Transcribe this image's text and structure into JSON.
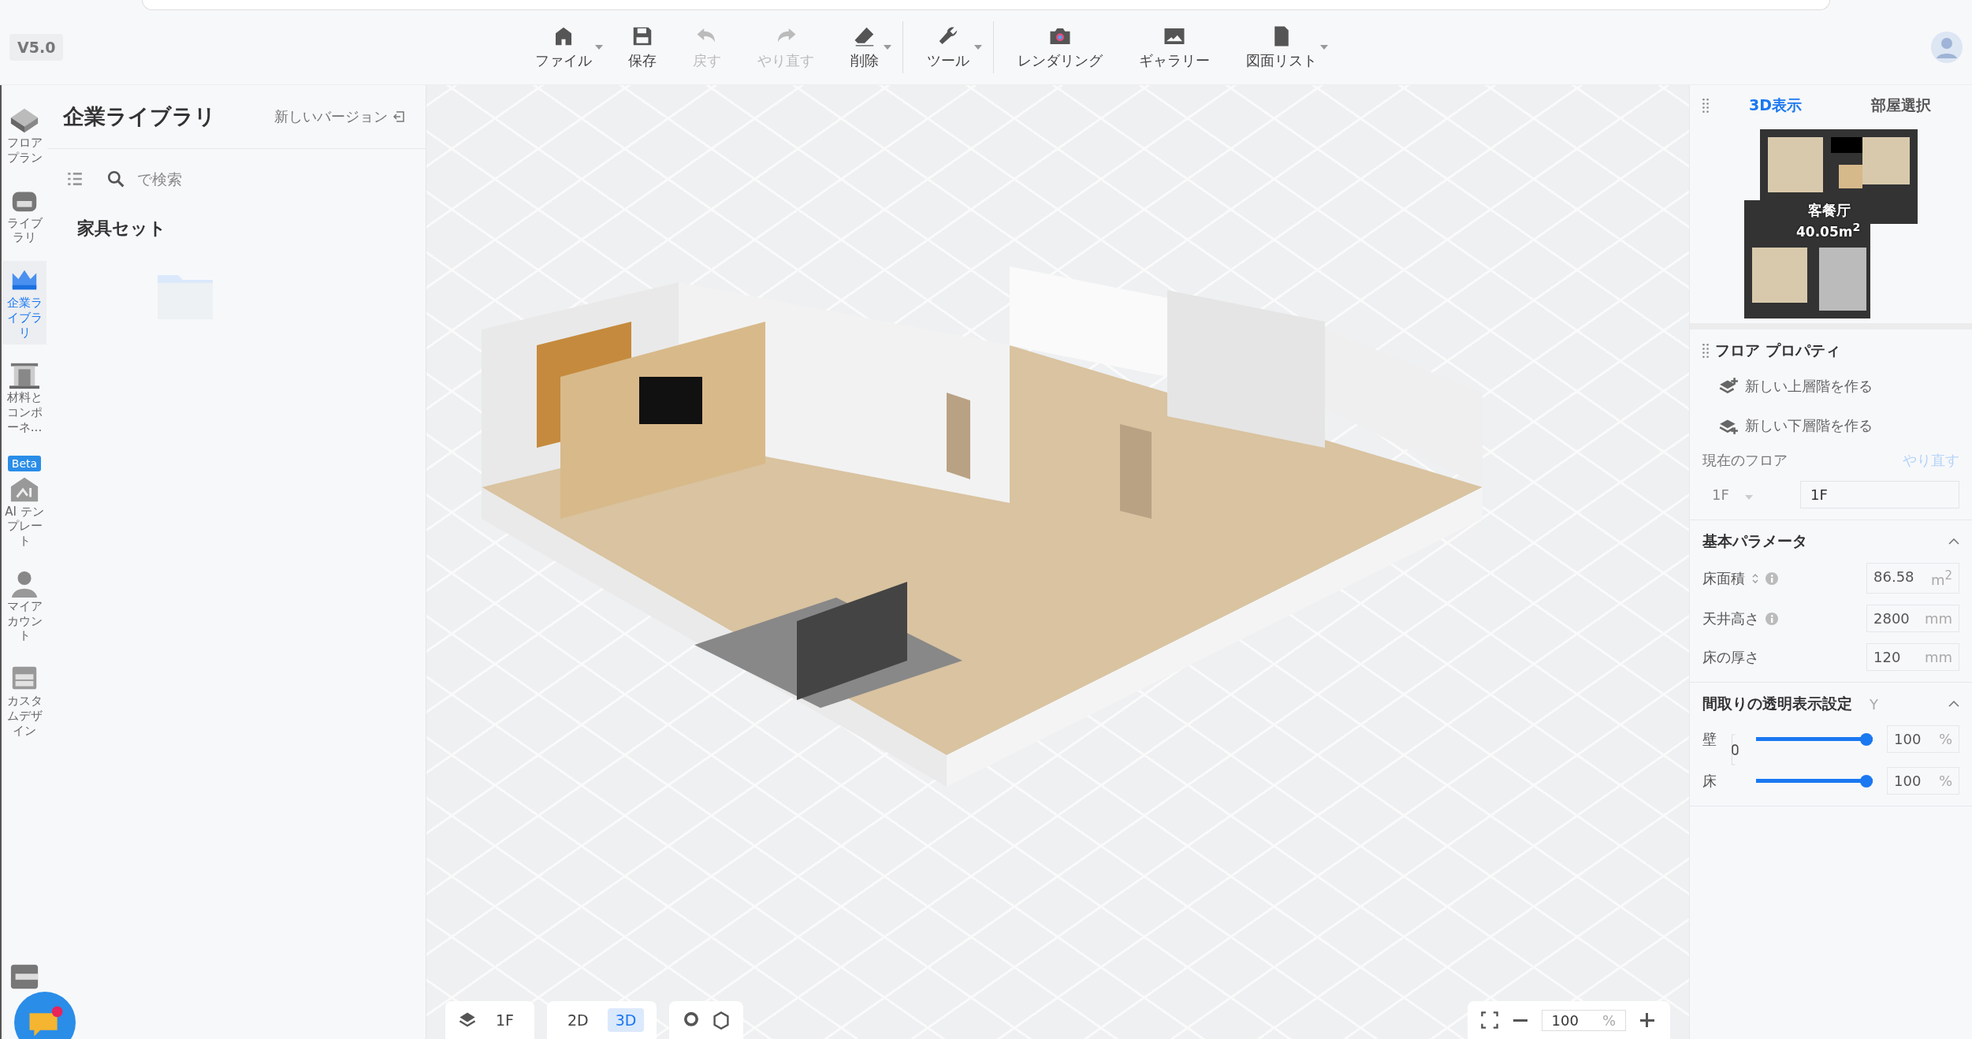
{
  "version": "V5.0",
  "toolbar": [
    {
      "label": "ファイル",
      "dropdown": true,
      "disabled": false,
      "divider_after": false
    },
    {
      "label": "保存",
      "dropdown": false,
      "disabled": false,
      "divider_after": false
    },
    {
      "label": "戻す",
      "dropdown": false,
      "disabled": true,
      "divider_after": false
    },
    {
      "label": "やり直す",
      "dropdown": false,
      "disabled": true,
      "divider_after": false
    },
    {
      "label": "削除",
      "dropdown": true,
      "disabled": false,
      "divider_after": true
    },
    {
      "label": "ツール",
      "dropdown": true,
      "disabled": false,
      "divider_after": true
    },
    {
      "label": "レンダリング",
      "dropdown": false,
      "disabled": false,
      "divider_after": false
    },
    {
      "label": "ギャラリー",
      "dropdown": false,
      "disabled": false,
      "divider_after": false
    },
    {
      "label": "図面リスト",
      "dropdown": true,
      "disabled": false,
      "divider_after": false
    }
  ],
  "rail": [
    {
      "label": "フロアプラン",
      "selected": false
    },
    {
      "label": "ライブラリ",
      "selected": false
    },
    {
      "label": "企業ライブラリ",
      "selected": true
    },
    {
      "label": "材料とコンポーネ...",
      "selected": false
    },
    {
      "label": "AI テンプレート",
      "selected": false,
      "badge": "Beta"
    },
    {
      "label": "マイアカウント",
      "selected": false
    },
    {
      "label": "カスタムデザイン",
      "selected": false
    }
  ],
  "library": {
    "title": "企業ライブラリ",
    "new_version": "新しいバージョン",
    "search": {
      "placeholder": "で検索"
    },
    "section": "家具セット"
  },
  "bottom_bar": {
    "floor": "1F",
    "views": [
      {
        "label": "2D",
        "selected": false
      },
      {
        "label": "3D",
        "selected": true
      }
    ],
    "zoom": "100",
    "zoom_unit": "%"
  },
  "right_panel": {
    "tabs": [
      {
        "label": "3D表示",
        "selected": true
      },
      {
        "label": "部屋選択",
        "selected": false
      }
    ],
    "minimap": {
      "room": "客餐厅",
      "area": "40.05m$^{2}$"
    },
    "floor_properties": {
      "title": "フロア プロパティ",
      "actions": [
        {
          "label": "新しい上層階を作る"
        },
        {
          "label": "新しい下層階を作る"
        }
      ],
      "current_floor_label": "現在のフロア",
      "redo": "やり直す",
      "floor_select": "1F",
      "floor_name": "1F"
    },
    "basic_params": {
      "title": "基本パラメータ",
      "expanded": true,
      "rows": [
        {
          "label": "床面積",
          "sort": true,
          "info": true,
          "value": "86.58",
          "unit": "m$^{2}$"
        },
        {
          "label": "天井高さ",
          "sort": false,
          "info": true,
          "value": "2800",
          "unit": "mm"
        },
        {
          "label": "床の厚さ",
          "sort": false,
          "info": false,
          "value": "120",
          "unit": "mm"
        }
      ]
    },
    "transparency": {
      "title": "間取りの透明表示設定",
      "hint": "Y",
      "expanded": true,
      "sliders": [
        {
          "label": "壁",
          "level": 1,
          "value": "100",
          "unit": "%"
        },
        {
          "label": "床",
          "level": 1,
          "value": "100",
          "unit": "%"
        }
      ]
    }
  }
}
